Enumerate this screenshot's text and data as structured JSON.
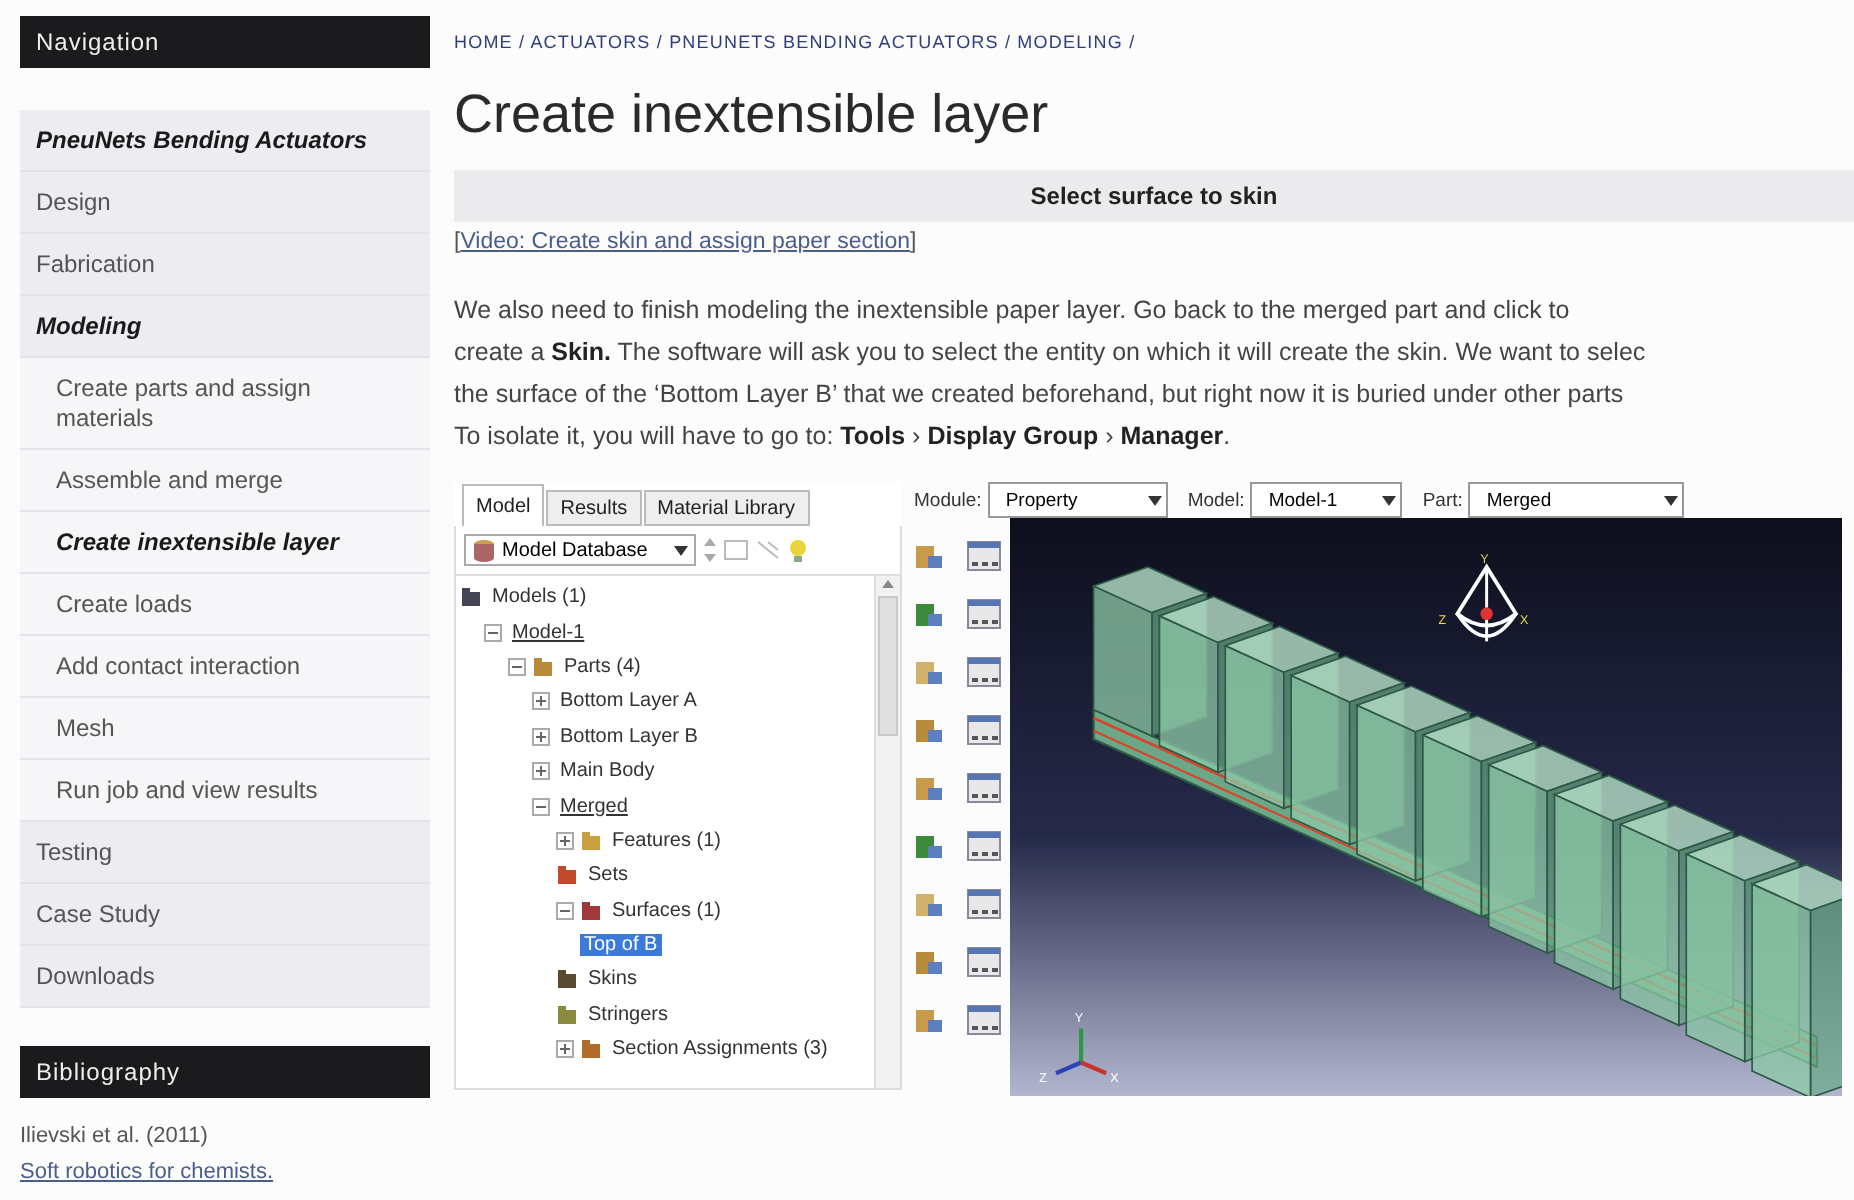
{
  "sidebar": {
    "nav_heading": "Navigation",
    "nav_items": [
      {
        "label": "PneuNets Bending Actuators",
        "kind": "section",
        "current": true
      },
      {
        "label": "Design",
        "kind": "section",
        "current": false
      },
      {
        "label": "Fabrication",
        "kind": "section",
        "current": false
      },
      {
        "label": "Modeling",
        "kind": "section",
        "current": true
      },
      {
        "label": "Create parts and assign materials",
        "kind": "sub",
        "current": false
      },
      {
        "label": "Assemble and merge",
        "kind": "sub",
        "current": false
      },
      {
        "label": "Create inextensible layer",
        "kind": "sub",
        "current": true
      },
      {
        "label": "Create loads",
        "kind": "sub",
        "current": false
      },
      {
        "label": "Add contact interaction",
        "kind": "sub",
        "current": false
      },
      {
        "label": "Mesh",
        "kind": "sub",
        "current": false
      },
      {
        "label": "Run job and view results",
        "kind": "sub",
        "current": false
      },
      {
        "label": "Testing",
        "kind": "section",
        "current": false
      },
      {
        "label": "Case Study",
        "kind": "section",
        "current": false
      },
      {
        "label": "Downloads",
        "kind": "section",
        "current": false
      }
    ],
    "bib_heading": "Bibliography",
    "bib_text": "Ilievski et al. (2011)",
    "bib_link": "Soft robotics for chemists."
  },
  "breadcrumb": "HOME / ACTUATORS / PNEUNETS BENDING ACTUATORS / MODELING /",
  "title": "Create inextensible layer",
  "band": "Select surface to skin",
  "video_open": "[",
  "video_link": "Video: Create skin and assign paper section",
  "video_close": "]",
  "paragraph_lines": [
    "We also need to finish modeling the inextensible paper layer. Go back to the merged part and click to",
    "create a **Skin.** The software will ask you to select the entity on which it will create the skin. We want to selec",
    "the surface of the ‘Bottom Layer B’ that we created beforehand, but right now it is buried under other parts",
    "To isolate it, you will have to go to: **Tools**  › **Display Group**  › **Manager**."
  ],
  "app": {
    "tabs": [
      {
        "label": "Model",
        "selected": true
      },
      {
        "label": "Results",
        "selected": false
      },
      {
        "label": "Material Library",
        "selected": false
      }
    ],
    "database": "Model Database",
    "tree": [
      {
        "label": "Models (1)",
        "kind": "models",
        "selected": false,
        "underlined": false,
        "children": [
          {
            "label": "Model-1",
            "expanded": true,
            "selected": false,
            "underlined": true,
            "children": [
              {
                "label": "Parts (4)",
                "kind": "parts",
                "expanded": true,
                "selected": false,
                "underlined": false,
                "children": [
                  {
                    "label": "Bottom Layer A",
                    "expanded": false,
                    "selected": false,
                    "underlined": false
                  },
                  {
                    "label": "Bottom Layer B",
                    "expanded": false,
                    "selected": false,
                    "underlined": false
                  },
                  {
                    "label": "Main Body",
                    "expanded": false,
                    "selected": false,
                    "underlined": false
                  },
                  {
                    "label": "Merged",
                    "expanded": true,
                    "selected": false,
                    "underlined": true,
                    "children": [
                      {
                        "label": "Features (1)",
                        "kind": "features",
                        "expanded": false,
                        "selected": false,
                        "underlined": false
                      },
                      {
                        "label": "Sets",
                        "kind": "sets",
                        "selected": false,
                        "underlined": false
                      },
                      {
                        "label": "Surfaces (1)",
                        "kind": "surfaces",
                        "expanded": true,
                        "selected": false,
                        "underlined": false,
                        "children": [
                          {
                            "label": "Top of B",
                            "selected": true,
                            "underlined": false
                          }
                        ]
                      },
                      {
                        "label": "Skins",
                        "kind": "skins",
                        "selected": false,
                        "underlined": false
                      },
                      {
                        "label": "Stringers",
                        "kind": "stringers",
                        "selected": false,
                        "underlined": false
                      },
                      {
                        "label": "Section Assignments (3)",
                        "kind": "sections",
                        "expanded": false,
                        "selected": false,
                        "underlined": false
                      }
                    ]
                  }
                ]
              }
            ]
          }
        ]
      }
    ],
    "context": [
      {
        "label": "Module:",
        "value": "Property"
      },
      {
        "label": "Model:",
        "value": "Model-1"
      },
      {
        "label": "Part:",
        "value": "Merged"
      }
    ],
    "triad_labels": [
      "Y",
      "Z",
      "X"
    ],
    "view_cube_labels": [
      "Y",
      "Z",
      "X"
    ]
  }
}
